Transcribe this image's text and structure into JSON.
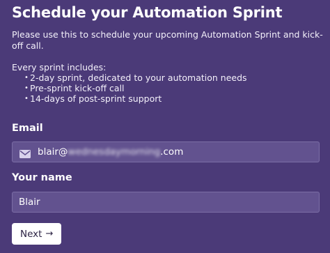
{
  "form": {
    "title": "Schedule your Automation Sprint",
    "intro": "Please use this to schedule your upcoming Automation Sprint and kick-off call.",
    "includes_heading": "Every sprint includes:",
    "includes_items": [
      "2-day sprint, dedicated to your automation needs",
      "Pre-sprint kick-off call",
      "14-days of post-sprint support"
    ],
    "email": {
      "label": "Email",
      "value_prefix": "blair@",
      "value_redacted": "wednesdaymorning",
      "value_suffix": ".com",
      "icon": "envelope-icon"
    },
    "name": {
      "label": "Your name",
      "value": "Blair"
    },
    "next_button": {
      "label": "Next",
      "icon": "arrow-right-icon"
    }
  },
  "colors": {
    "background": "#4b3a78",
    "field_background": "#62528f",
    "field_border": "#7c6ea6",
    "button_background": "#ffffff",
    "button_text": "#2c2344"
  }
}
